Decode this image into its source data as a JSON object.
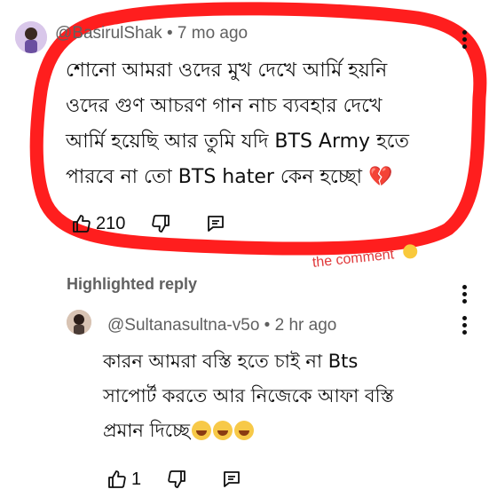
{
  "comment": {
    "author": "@BasirulShak",
    "separator": "•",
    "time": "7 mo ago",
    "lines": [
      "শোনো আমরা ওদের মুখ দেখে আর্মি হয়নি",
      "ওদের গুণ আচরণ গান নাচ ব্যবহার দেখে",
      "আর্মি হয়েছি আর তুমি যদি BTS Army হতে",
      "পারবে না তো  BTS hater কেন হচ্ছো 💔"
    ],
    "likes": "210"
  },
  "annotation": {
    "text": "the comment",
    "color": "#e0393b"
  },
  "highlighted_label": "Highlighted reply",
  "reply": {
    "author": "@Sultanasultna-v5o",
    "separator": "•",
    "time": "2 hr ago",
    "lines": [
      "কারন আমরা বস্তি হতে চাই না Bts",
      "সাপোর্ট করতে আর নিজেকে আফা বস্তি",
      "প্রমান দিচ্ছে"
    ],
    "likes": "1"
  },
  "icons": {
    "like": "thumbs-up-icon",
    "dislike": "thumbs-down-icon",
    "reply": "reply-icon",
    "more": "more-vert-icon"
  },
  "colors": {
    "highlight_circle": "#ff1e1e",
    "meta_text": "#606060"
  }
}
